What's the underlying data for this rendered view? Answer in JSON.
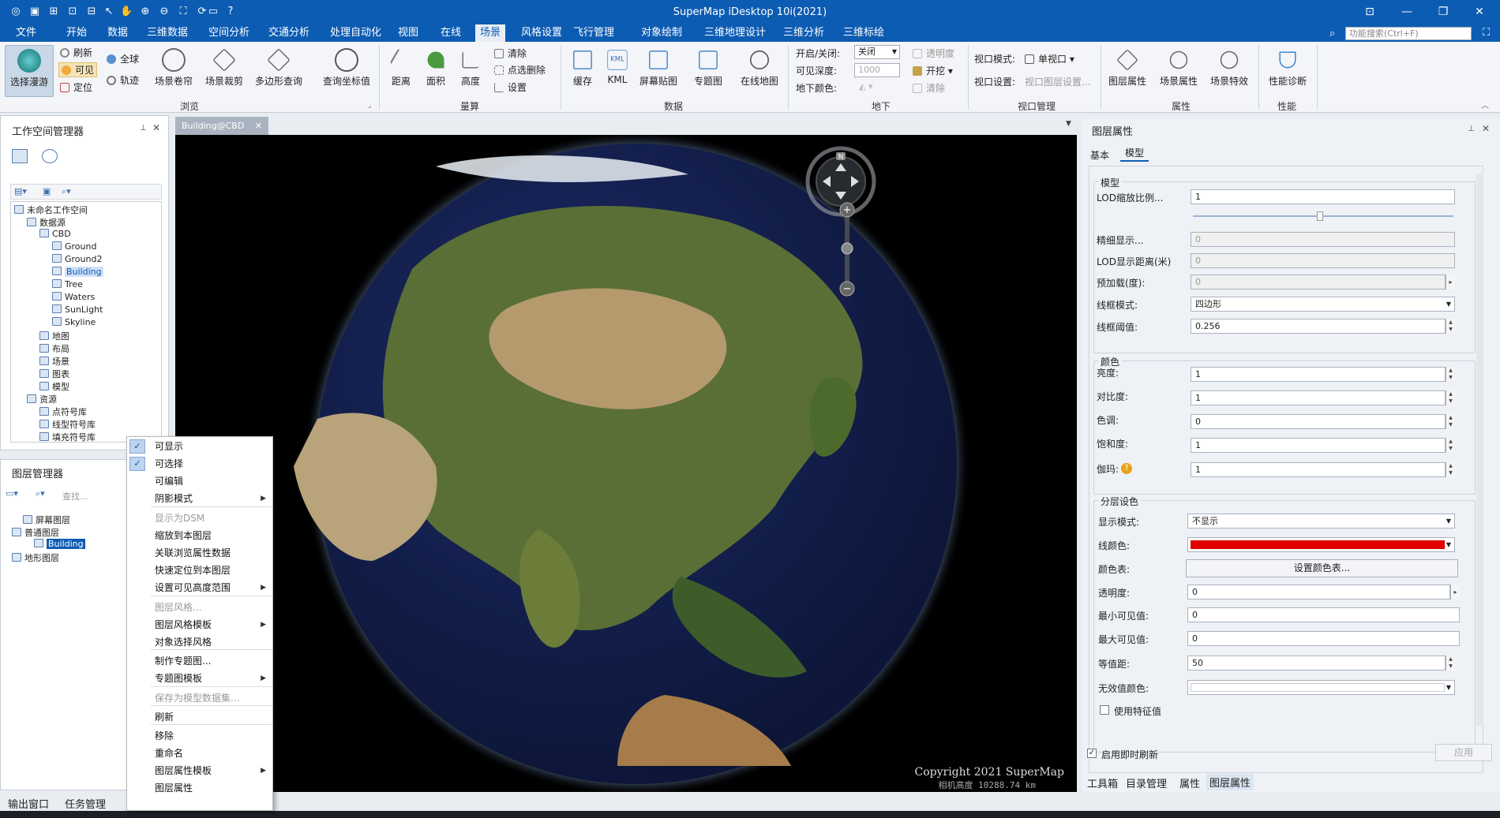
{
  "window": {
    "title": "SuperMap iDesktop 10i(2021)"
  },
  "search": {
    "placeholder": "功能搜索(Ctrl+F)"
  },
  "menu": [
    "文件",
    "开始",
    "数据",
    "三维数据",
    "空间分析",
    "交通分析",
    "处理自动化",
    "视图",
    "在线",
    "场景",
    "风格设置",
    "飞行管理",
    "对象绘制",
    "三维地理设计",
    "三维分析",
    "三维标绘"
  ],
  "menu_active": "场景",
  "ribbon": {
    "browse": {
      "select_roam": "选择漫游",
      "refresh": "刷新",
      "visible": "可见",
      "locate": "定位",
      "globe": "全球",
      "track": "轨迹",
      "scene_roll": "场景卷帘",
      "scene_clip": "场景裁剪",
      "polygon_query": "多边形查询",
      "query_coord": "查询坐标值",
      "group": "浏览"
    },
    "measure": {
      "distance": "距离",
      "area": "面积",
      "height": "高度",
      "clear": "清除",
      "point_delete": "点选删除",
      "settings": "设置",
      "group": "量算"
    },
    "data": {
      "cache": "缓存",
      "kml": "KML",
      "screen_map": "屏幕贴图",
      "theme_map": "专题图",
      "online_map": "在线地图",
      "group": "数据"
    },
    "underground": {
      "toggle_label": "开启/关闭:",
      "toggle_value": "关闭",
      "depth_label": "可见深度:",
      "depth_value": "1000",
      "color_label": "地下颜色:",
      "transparency": "透明度",
      "excavate": "开挖",
      "clear": "清除",
      "group": "地下"
    },
    "viewport": {
      "mode_label": "视口模式:",
      "mode_value": "单视口",
      "settings_label": "视口设置:",
      "layer_settings": "视口图层设置...",
      "group": "视口管理"
    },
    "attr": {
      "layer_attr": "图层属性",
      "scene_attr": "场景属性",
      "scene_effect": "场景特效",
      "group": "属性"
    },
    "perf": {
      "diagnose": "性能诊断",
      "group": "性能"
    }
  },
  "workspace": {
    "title": "工作空间管理器",
    "tree": [
      "未命名工作空间",
      "数据源",
      "CBD",
      "Ground",
      "Ground2",
      "Building",
      "Tree",
      "Waters",
      "SunLight",
      "Skyline",
      "地图",
      "布局",
      "场景",
      "图表",
      "模型",
      "资源",
      "点符号库",
      "线型符号库",
      "填充符号库"
    ]
  },
  "layers": {
    "title": "图层管理器",
    "search_placeholder": "查找...",
    "items": [
      "屏幕图层",
      "普通图层",
      "Building",
      "地形图层"
    ]
  },
  "context_menu": [
    {
      "label": "可显示",
      "checked": true
    },
    {
      "label": "可选择",
      "checked": true
    },
    {
      "label": "可编辑"
    },
    {
      "label": "阴影模式",
      "arrow": true
    },
    {
      "label": "显示为DSM",
      "disabled": true
    },
    {
      "label": "缩放到本图层"
    },
    {
      "label": "关联浏览属性数据"
    },
    {
      "label": "快速定位到本图层"
    },
    {
      "label": "设置可见高度范围",
      "arrow": true
    },
    {
      "label": "图层风格...",
      "disabled": true
    },
    {
      "label": "图层风格模板",
      "arrow": true
    },
    {
      "label": "对象选择风格"
    },
    {
      "label": "制作专题图..."
    },
    {
      "label": "专题图模板",
      "arrow": true
    },
    {
      "label": "保存为模型数据集...",
      "disabled": true
    },
    {
      "label": "刷新"
    },
    {
      "label": "移除"
    },
    {
      "label": "重命名"
    },
    {
      "label": "图层属性模板",
      "arrow": true
    },
    {
      "label": "图层属性"
    }
  ],
  "scene": {
    "tab": "Building@CBD",
    "copyright": "Copyright 2021 SuperMap",
    "camera": "相机高度 10288.74 km",
    "compass_n": "N"
  },
  "props": {
    "title": "图层属性",
    "tabs": [
      "基本",
      "模型"
    ],
    "model_group": "模型",
    "lod_scale_label": "LOD缩放比例...",
    "lod_scale": "1",
    "fine_display_label": "精细显示...",
    "fine_display": "0",
    "lod_distance_label": "LOD显示距离(米)",
    "lod_distance": "0",
    "preload_label": "预加载(度):",
    "preload": "0",
    "wire_mode_label": "线框模式:",
    "wire_mode": "四边形",
    "wire_threshold_label": "线框阈值:",
    "wire_threshold": "0.256",
    "color_group": "颜色",
    "brightness_label": "亮度:",
    "brightness": "1",
    "contrast_label": "对比度:",
    "contrast": "1",
    "hue_label": "色调:",
    "hue": "0",
    "saturation_label": "饱和度:",
    "saturation": "1",
    "gamma_label": "伽玛:",
    "gamma": "1",
    "layer_color_group": "分层设色",
    "display_mode_label": "显示模式:",
    "display_mode": "不显示",
    "line_color_label": "线颜色:",
    "line_color": "#e00000",
    "color_table_label": "颜色表:",
    "color_table_button": "设置颜色表...",
    "transparency_label": "透明度:",
    "transparency": "0",
    "min_visible_label": "最小可见值:",
    "min_visible": "0",
    "max_visible_label": "最大可见值:",
    "max_visible": "0",
    "interval_label": "等值距:",
    "interval": "50",
    "invalid_color_label": "无效值颜色:",
    "use_feature_label": "使用特征值",
    "instant_refresh_label": "启用即时刷新",
    "apply": "应用"
  },
  "bottom_tabs_left": [
    "输出窗口",
    "任务管理"
  ],
  "bottom_tabs_right": [
    "工具箱",
    "目录管理",
    "属性",
    "图层属性"
  ],
  "colors": {
    "accent": "#0d5cb3",
    "ocean": "#12204d",
    "land": "#4f6d2f"
  }
}
